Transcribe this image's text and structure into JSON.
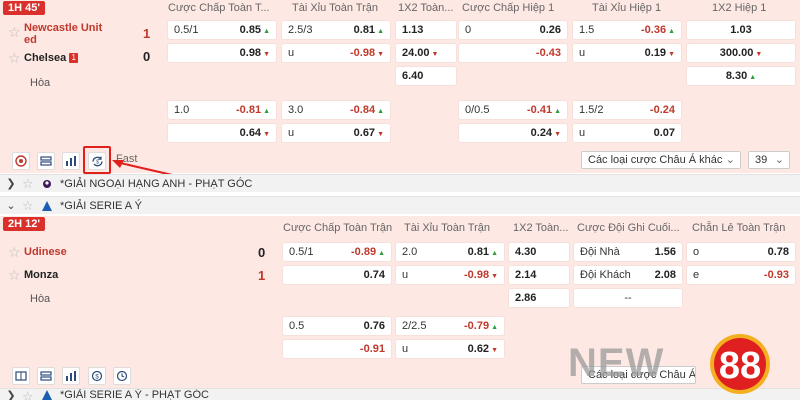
{
  "colors": {
    "accent": "#d9302c",
    "match_bg": "#fde8e4",
    "up": "#2e9d3a",
    "down": "#c0392b"
  },
  "match1": {
    "time": "1H 45'",
    "headers": [
      "Cược Chấp Toàn T...",
      "Tài Xỉu Toàn Trận",
      "1X2 Toàn...",
      "Cược Chấp Hiệp 1",
      "Tài Xỉu Hiệp 1",
      "1X2 Hiệp 1"
    ],
    "home": {
      "name_line1": "Newcastle Unit",
      "name_line2": "ed",
      "score": "1"
    },
    "away": {
      "name": "Chelsea",
      "red_cards": "1",
      "score": "0"
    },
    "draw": "Hòa",
    "rows": {
      "r1": {
        "hc_line": "0.5/1",
        "hc_odd": "0.85",
        "ou_line": "2.5/3",
        "ou_odd": "0.81",
        "x12": "1.13",
        "h1hc_line": "0",
        "h1hc_odd": "0.26",
        "h1ou_line": "1.5",
        "h1ou_odd": "-0.36",
        "h1x12": "1.03"
      },
      "r2": {
        "hc_odd": "0.98",
        "ou_line": "u",
        "ou_odd": "-0.98",
        "x12": "24.00",
        "h1hc_odd": "-0.43",
        "h1ou_line": "u",
        "h1ou_odd": "0.19",
        "h1x12": "300.00"
      },
      "r3": {
        "x12": "6.40",
        "h1x12": "8.30"
      },
      "r4": {
        "hc_line": "1.0",
        "hc_odd": "-0.81",
        "ou_line": "3.0",
        "ou_odd": "-0.84",
        "h1hc_line": "0/0.5",
        "h1hc_odd": "-0.41",
        "h1ou_line": "1.5/2",
        "h1ou_odd": "-0.24"
      },
      "r5": {
        "hc_odd": "0.64",
        "ou_line": "u",
        "ou_odd": "0.67",
        "h1hc_odd": "0.24",
        "h1ou_line": "u",
        "h1ou_odd": "0.07"
      }
    },
    "toolbar": {
      "fast": "Fast",
      "select": "Các loại cược Châu Á khác",
      "count": "39"
    }
  },
  "leagues": {
    "corner": "*GIẢI NGOẠI HẠNG ANH - PHẠT GÓC",
    "serie_a": "*GIẢI SERIE A Ý",
    "serie_a_corner": "*GIẢI SERIE A Ý - PHẠT GÓC"
  },
  "match2": {
    "time": "2H 12'",
    "headers": [
      "Cược Chấp Toàn Trận",
      "Tài Xỉu Toàn Trận",
      "1X2 Toàn...",
      "Cược Đội Ghi Cuối...",
      "Chẵn Lẻ Toàn Trận"
    ],
    "home": {
      "name": "Udinese",
      "score": "0"
    },
    "away": {
      "name": "Monza",
      "score": "1"
    },
    "draw": "Hòa",
    "rows": {
      "r1": {
        "hc_line": "0.5/1",
        "hc_odd": "-0.89",
        "ou_line": "2.0",
        "ou_odd": "0.81",
        "x12": "4.30",
        "last_label": "Đội Nhà",
        "last_odd": "1.56",
        "oe_label": "o",
        "oe_odd": "0.78"
      },
      "r2": {
        "hc_odd": "0.74",
        "ou_line": "u",
        "ou_odd": "-0.98",
        "x12": "2.14",
        "last_label": "Đội Khách",
        "last_odd": "2.08",
        "oe_label": "e",
        "oe_odd": "-0.93"
      },
      "r3": {
        "x12": "2.86",
        "last_label": "--"
      },
      "r4": {
        "hc_line": "0.5",
        "hc_odd": "0.76",
        "ou_line": "2/2.5",
        "ou_odd": "-0.79"
      },
      "r5": {
        "hc_odd": "-0.91",
        "ou_line": "u",
        "ou_odd": "0.62"
      }
    },
    "toolbar": {
      "select": "Các loại cược Châu Á khác"
    }
  },
  "brand": {
    "logo_text": "NEW",
    "logo_number": "88"
  }
}
